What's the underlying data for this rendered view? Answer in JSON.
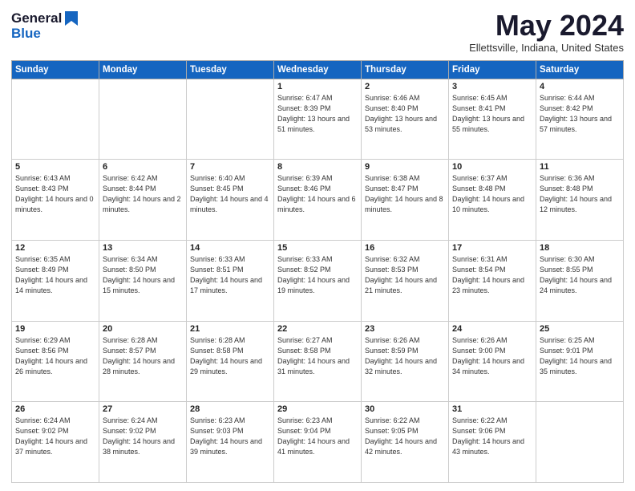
{
  "logo": {
    "line1": "General",
    "line2": "Blue"
  },
  "title": "May 2024",
  "location": "Ellettsville, Indiana, United States",
  "days_of_week": [
    "Sunday",
    "Monday",
    "Tuesday",
    "Wednesday",
    "Thursday",
    "Friday",
    "Saturday"
  ],
  "weeks": [
    [
      {
        "day": "",
        "sunrise": "",
        "sunset": "",
        "daylight": ""
      },
      {
        "day": "",
        "sunrise": "",
        "sunset": "",
        "daylight": ""
      },
      {
        "day": "",
        "sunrise": "",
        "sunset": "",
        "daylight": ""
      },
      {
        "day": "1",
        "sunrise": "Sunrise: 6:47 AM",
        "sunset": "Sunset: 8:39 PM",
        "daylight": "Daylight: 13 hours and 51 minutes."
      },
      {
        "day": "2",
        "sunrise": "Sunrise: 6:46 AM",
        "sunset": "Sunset: 8:40 PM",
        "daylight": "Daylight: 13 hours and 53 minutes."
      },
      {
        "day": "3",
        "sunrise": "Sunrise: 6:45 AM",
        "sunset": "Sunset: 8:41 PM",
        "daylight": "Daylight: 13 hours and 55 minutes."
      },
      {
        "day": "4",
        "sunrise": "Sunrise: 6:44 AM",
        "sunset": "Sunset: 8:42 PM",
        "daylight": "Daylight: 13 hours and 57 minutes."
      }
    ],
    [
      {
        "day": "5",
        "sunrise": "Sunrise: 6:43 AM",
        "sunset": "Sunset: 8:43 PM",
        "daylight": "Daylight: 14 hours and 0 minutes."
      },
      {
        "day": "6",
        "sunrise": "Sunrise: 6:42 AM",
        "sunset": "Sunset: 8:44 PM",
        "daylight": "Daylight: 14 hours and 2 minutes."
      },
      {
        "day": "7",
        "sunrise": "Sunrise: 6:40 AM",
        "sunset": "Sunset: 8:45 PM",
        "daylight": "Daylight: 14 hours and 4 minutes."
      },
      {
        "day": "8",
        "sunrise": "Sunrise: 6:39 AM",
        "sunset": "Sunset: 8:46 PM",
        "daylight": "Daylight: 14 hours and 6 minutes."
      },
      {
        "day": "9",
        "sunrise": "Sunrise: 6:38 AM",
        "sunset": "Sunset: 8:47 PM",
        "daylight": "Daylight: 14 hours and 8 minutes."
      },
      {
        "day": "10",
        "sunrise": "Sunrise: 6:37 AM",
        "sunset": "Sunset: 8:48 PM",
        "daylight": "Daylight: 14 hours and 10 minutes."
      },
      {
        "day": "11",
        "sunrise": "Sunrise: 6:36 AM",
        "sunset": "Sunset: 8:48 PM",
        "daylight": "Daylight: 14 hours and 12 minutes."
      }
    ],
    [
      {
        "day": "12",
        "sunrise": "Sunrise: 6:35 AM",
        "sunset": "Sunset: 8:49 PM",
        "daylight": "Daylight: 14 hours and 14 minutes."
      },
      {
        "day": "13",
        "sunrise": "Sunrise: 6:34 AM",
        "sunset": "Sunset: 8:50 PM",
        "daylight": "Daylight: 14 hours and 15 minutes."
      },
      {
        "day": "14",
        "sunrise": "Sunrise: 6:33 AM",
        "sunset": "Sunset: 8:51 PM",
        "daylight": "Daylight: 14 hours and 17 minutes."
      },
      {
        "day": "15",
        "sunrise": "Sunrise: 6:33 AM",
        "sunset": "Sunset: 8:52 PM",
        "daylight": "Daylight: 14 hours and 19 minutes."
      },
      {
        "day": "16",
        "sunrise": "Sunrise: 6:32 AM",
        "sunset": "Sunset: 8:53 PM",
        "daylight": "Daylight: 14 hours and 21 minutes."
      },
      {
        "day": "17",
        "sunrise": "Sunrise: 6:31 AM",
        "sunset": "Sunset: 8:54 PM",
        "daylight": "Daylight: 14 hours and 23 minutes."
      },
      {
        "day": "18",
        "sunrise": "Sunrise: 6:30 AM",
        "sunset": "Sunset: 8:55 PM",
        "daylight": "Daylight: 14 hours and 24 minutes."
      }
    ],
    [
      {
        "day": "19",
        "sunrise": "Sunrise: 6:29 AM",
        "sunset": "Sunset: 8:56 PM",
        "daylight": "Daylight: 14 hours and 26 minutes."
      },
      {
        "day": "20",
        "sunrise": "Sunrise: 6:28 AM",
        "sunset": "Sunset: 8:57 PM",
        "daylight": "Daylight: 14 hours and 28 minutes."
      },
      {
        "day": "21",
        "sunrise": "Sunrise: 6:28 AM",
        "sunset": "Sunset: 8:58 PM",
        "daylight": "Daylight: 14 hours and 29 minutes."
      },
      {
        "day": "22",
        "sunrise": "Sunrise: 6:27 AM",
        "sunset": "Sunset: 8:58 PM",
        "daylight": "Daylight: 14 hours and 31 minutes."
      },
      {
        "day": "23",
        "sunrise": "Sunrise: 6:26 AM",
        "sunset": "Sunset: 8:59 PM",
        "daylight": "Daylight: 14 hours and 32 minutes."
      },
      {
        "day": "24",
        "sunrise": "Sunrise: 6:26 AM",
        "sunset": "Sunset: 9:00 PM",
        "daylight": "Daylight: 14 hours and 34 minutes."
      },
      {
        "day": "25",
        "sunrise": "Sunrise: 6:25 AM",
        "sunset": "Sunset: 9:01 PM",
        "daylight": "Daylight: 14 hours and 35 minutes."
      }
    ],
    [
      {
        "day": "26",
        "sunrise": "Sunrise: 6:24 AM",
        "sunset": "Sunset: 9:02 PM",
        "daylight": "Daylight: 14 hours and 37 minutes."
      },
      {
        "day": "27",
        "sunrise": "Sunrise: 6:24 AM",
        "sunset": "Sunset: 9:02 PM",
        "daylight": "Daylight: 14 hours and 38 minutes."
      },
      {
        "day": "28",
        "sunrise": "Sunrise: 6:23 AM",
        "sunset": "Sunset: 9:03 PM",
        "daylight": "Daylight: 14 hours and 39 minutes."
      },
      {
        "day": "29",
        "sunrise": "Sunrise: 6:23 AM",
        "sunset": "Sunset: 9:04 PM",
        "daylight": "Daylight: 14 hours and 41 minutes."
      },
      {
        "day": "30",
        "sunrise": "Sunrise: 6:22 AM",
        "sunset": "Sunset: 9:05 PM",
        "daylight": "Daylight: 14 hours and 42 minutes."
      },
      {
        "day": "31",
        "sunrise": "Sunrise: 6:22 AM",
        "sunset": "Sunset: 9:06 PM",
        "daylight": "Daylight: 14 hours and 43 minutes."
      },
      {
        "day": "",
        "sunrise": "",
        "sunset": "",
        "daylight": ""
      }
    ]
  ]
}
